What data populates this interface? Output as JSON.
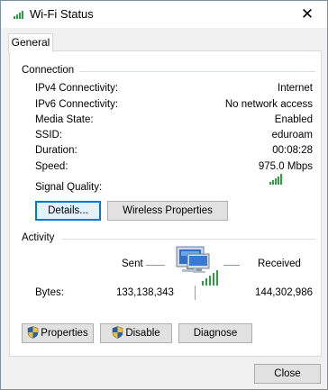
{
  "window": {
    "title": "Wi-Fi Status",
    "close_glyph": "✕"
  },
  "tabs": [
    {
      "label": "General",
      "selected": true
    }
  ],
  "connection": {
    "heading": "Connection",
    "rows": [
      {
        "label": "IPv4 Connectivity:",
        "value": "Internet"
      },
      {
        "label": "IPv6 Connectivity:",
        "value": "No network access"
      },
      {
        "label": "Media State:",
        "value": "Enabled"
      },
      {
        "label": "SSID:",
        "value": "eduroam"
      },
      {
        "label": "Duration:",
        "value": "00:08:28"
      },
      {
        "label": "Speed:",
        "value": "975.0 Mbps"
      }
    ],
    "signal_label": "Signal Quality:",
    "signal_bars_lit": 5,
    "signal_bars_total": 5,
    "details_button": "Details...",
    "wireless_button": "Wireless Properties"
  },
  "activity": {
    "heading": "Activity",
    "sent_label": "Sent",
    "received_label": "Received",
    "bytes_label": "Bytes:",
    "bytes_sent": "133,138,343",
    "bytes_received": "144,302,986"
  },
  "actions": {
    "properties_button": "Properties",
    "disable_button": "Disable",
    "diagnose_button": "Diagnose"
  },
  "footer": {
    "close_button": "Close"
  },
  "colors": {
    "signal_green": "#2e9d45",
    "focus_blue": "#0078d7"
  },
  "icons": {
    "title": "wifi-signal-icon",
    "shield": "uac-shield-icon",
    "network": "network-computer-icon"
  }
}
